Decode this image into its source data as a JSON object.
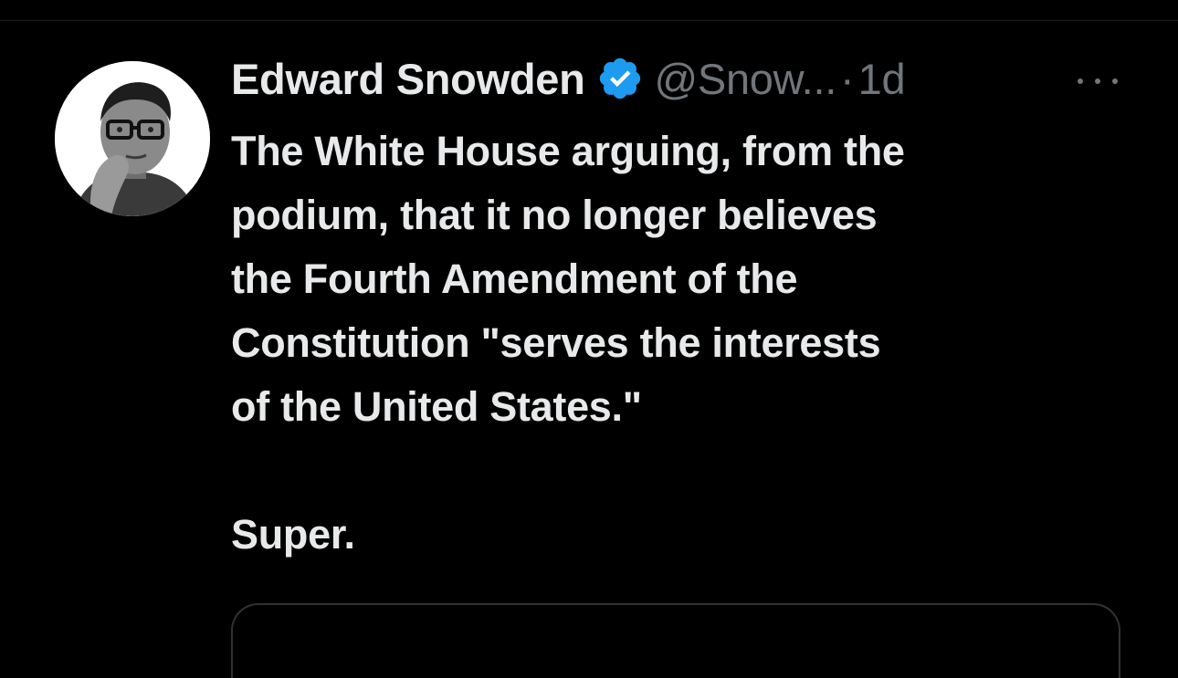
{
  "tweet": {
    "author": {
      "display_name": "Edward Snowden",
      "handle": "@Snow...",
      "verified": true
    },
    "separator": "·",
    "timestamp": "1d",
    "more_icon": "ellipsis-horizontal-icon",
    "text_lines": [
      "The White House arguing, from the",
      "podium, that it no longer believes",
      "the Fourth Amendment of the",
      "Constitution \"serves the interests",
      "of the United States.\""
    ],
    "text_last": "Super."
  },
  "colors": {
    "background": "#000000",
    "primary_text": "#e7e9ea",
    "secondary_text": "#71767b",
    "verified_blue": "#1d9bf0",
    "border": "#2f3336"
  }
}
